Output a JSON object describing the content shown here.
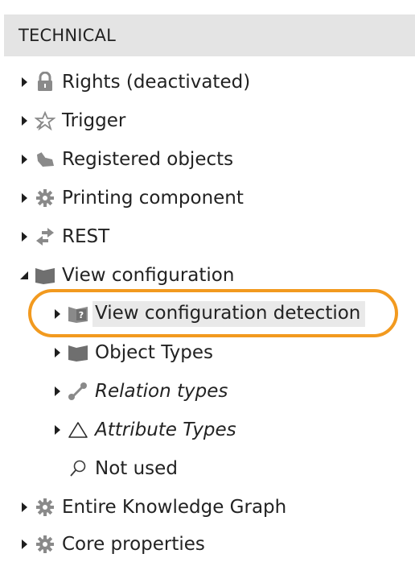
{
  "panel": {
    "title": "TECHNICAL"
  },
  "tree": {
    "items": [
      {
        "label": "Rights (deactivated)",
        "icon": "lock-icon",
        "expanded": false
      },
      {
        "label": "Trigger",
        "icon": "trigger-icon",
        "expanded": false
      },
      {
        "label": "Registered objects",
        "icon": "registered-objects-icon",
        "expanded": false
      },
      {
        "label": "Printing component",
        "icon": "gear-icon",
        "expanded": false
      },
      {
        "label": "REST",
        "icon": "rest-icon",
        "expanded": false
      },
      {
        "label": "View configuration",
        "icon": "folder-icon",
        "expanded": true,
        "children": [
          {
            "label": "View configuration detection",
            "icon": "folder-question-icon",
            "expanded": false,
            "selected": true
          },
          {
            "label": "Object Types",
            "icon": "folder-icon",
            "expanded": false
          },
          {
            "label": "Relation types",
            "icon": "relation-icon",
            "expanded": false,
            "italic": true
          },
          {
            "label": "Attribute Types",
            "icon": "triangle-icon",
            "expanded": false,
            "italic": true
          },
          {
            "label": "Not used",
            "icon": "search-icon",
            "leaf": true
          }
        ]
      },
      {
        "label": "Entire Knowledge Graph",
        "icon": "gear-icon",
        "expanded": false
      },
      {
        "label": "Core properties",
        "icon": "gear-icon",
        "expanded": false
      }
    ]
  },
  "colors": {
    "header_bg": "#e4e4e4",
    "icon_gray": "#8a8a8a",
    "folder_dark": "#6f6f6f",
    "selection_bg": "#e9e9e9",
    "highlight_ring": "#f29a1f"
  }
}
